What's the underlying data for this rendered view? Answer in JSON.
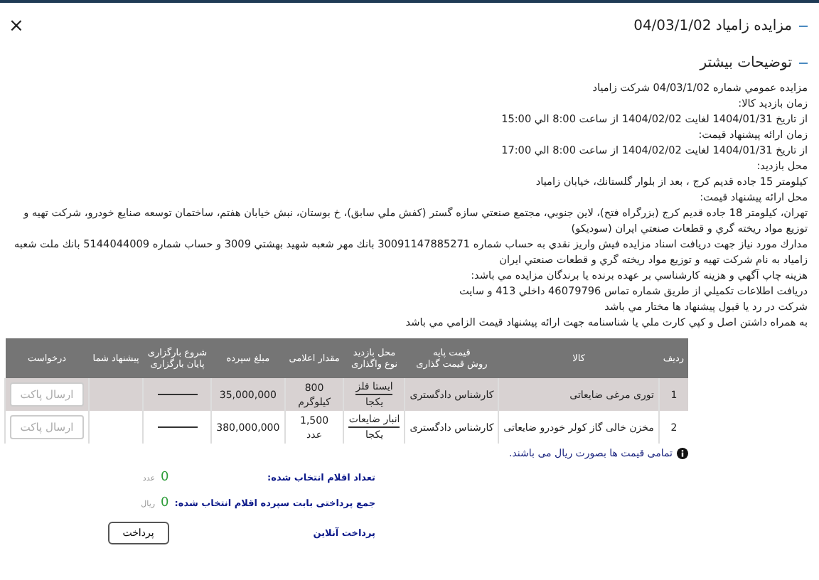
{
  "header": {
    "title": "مزایده زامیاد 04/03/1/02",
    "close": "×"
  },
  "section": {
    "title": "توضیحات بیشتر"
  },
  "paragraphs": [
    "مزايده عمومي شماره 04/03/1/02 شركت زامياد",
    "زمان بازديد كالا:",
    "از تاريخ 1404/01/31 لغايت 1404/02/02 از ساعت 8:00 الي 15:00",
    "زمان ارائه پيشنهاد قيمت:",
    "از تاريخ 1404/01/31 لغايت 1404/02/02 از ساعت 8:00 الي 17:00",
    "محل بازديد:",
    "كيلومتر 15 جاده قديم كرج ، بعد از بلوار گلستانك، خيابان زامياد",
    "محل ارائه پيشنهاد قيمت:",
    "تهران، كيلومتر 18 جاده قديم كرج (بزرگراه فتح)، لاين جنوبي، مجتمع صنعتي سازه گستر (كفش ملي سابق)، خ بوستان، نبش خيابان هفتم، ساختمان توسعه صنايع خودرو، شركت تهيه و توزيع مواد ريخته گري و قطعات صنعتي ايران (سوديكو)",
    "مدارك مورد نياز جهت دريافت اسناد مزايده فيش واريز نقدي به حساب شماره 30091147885271 بانك مهر شعبه شهيد بهشتي 3009 و حساب شماره 5144044009 بانك ملت شعبه زامياد به نام شركت تهيه و توزيع مواد ريخته گري و قطعات صنعتي ايران",
    "هزينه چاپ آگهي و هزينه كارشناسي بر عهده برنده يا برندگان مزايده مي باشد:",
    "دريافت اطلاعات تكميلي از طريق شماره تماس 46079796 داخلي 413 و سايت",
    "شركت در رد يا قبول پيشنهاد ها مختار مي باشد",
    "به همراه داشتن اصل و كپي كارت ملي يا شناسنامه جهت ارائه پيشنهاد قيمت الزامي مي باشد"
  ],
  "table": {
    "columns": [
      [
        "ردیف"
      ],
      [
        "کالا"
      ],
      [
        "قیمت پایه",
        "روش قیمت گذاری"
      ],
      [
        "محل بازدید",
        "نوع واگذاری"
      ],
      [
        "مقدار اعلامی"
      ],
      [
        "مبلغ سپرده"
      ],
      [
        "شروع بارگزاری",
        "پایان بارگزاری"
      ],
      [
        "پیشنهاد شما"
      ],
      [
        "درخواست"
      ]
    ],
    "rows": [
      {
        "index": "1",
        "item": "توری مرغی ضایعاتی",
        "pricing": "کارشناس دادگستری",
        "location": "ایستا فلز",
        "transfer": "یکجا",
        "quantity": "800",
        "unit": "کیلوگرم",
        "deposit": "35,000,000",
        "button": "ارسال پاکت",
        "disabled": true
      },
      {
        "index": "2",
        "item": "مخزن خالی گاز کولر خودرو ضایعاتی",
        "pricing": "کارشناس دادگستری",
        "location": "انبار ضایعات",
        "transfer": "یکجا",
        "quantity": "1,500",
        "unit": "عدد",
        "deposit": "380,000,000",
        "button": "ارسال پاکت",
        "disabled": true
      }
    ]
  },
  "note": "تمامی قیمت ها بصورت ریال می باشند.",
  "summary": [
    {
      "label": "تعداد اقلام انتخاب شده:",
      "value": "0",
      "unit": "عدد"
    },
    {
      "label": "جمع پرداختی بابت سپرده اقلام انتخاب شده:",
      "value": "0",
      "unit": "ریال"
    }
  ],
  "payment": {
    "label": "پرداخت آنلاین",
    "button": "پرداخت"
  }
}
